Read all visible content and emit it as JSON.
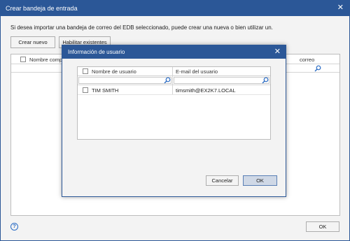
{
  "window": {
    "title": "Crear bandeja de entrada",
    "close_glyph": "✕"
  },
  "intro_text": "Si desea importar una bandeja de correo del EDB seleccionado, puede crear una nueva o bien utilizar un.",
  "toolbar": {
    "create_new_label": "Crear nuevo",
    "enable_existing_label": "Habilitar existentes"
  },
  "outer_grid": {
    "columns": [
      "Nombre comple",
      "correo"
    ]
  },
  "footer": {
    "ok_label": "OK",
    "help_glyph": "?"
  },
  "dialog": {
    "title": "Información de usuario",
    "close_glyph": "✕",
    "columns": [
      "Nombre de usuario",
      "E-mail del usuario"
    ],
    "rows": [
      {
        "name": "TIM SMITH",
        "email": "timsmith@EX2K7.LOCAL"
      }
    ],
    "cancel_label": "Cancelar",
    "ok_label": "OK"
  },
  "colors": {
    "title_bar": "#2b5797",
    "accent": "#2b6cc4"
  }
}
